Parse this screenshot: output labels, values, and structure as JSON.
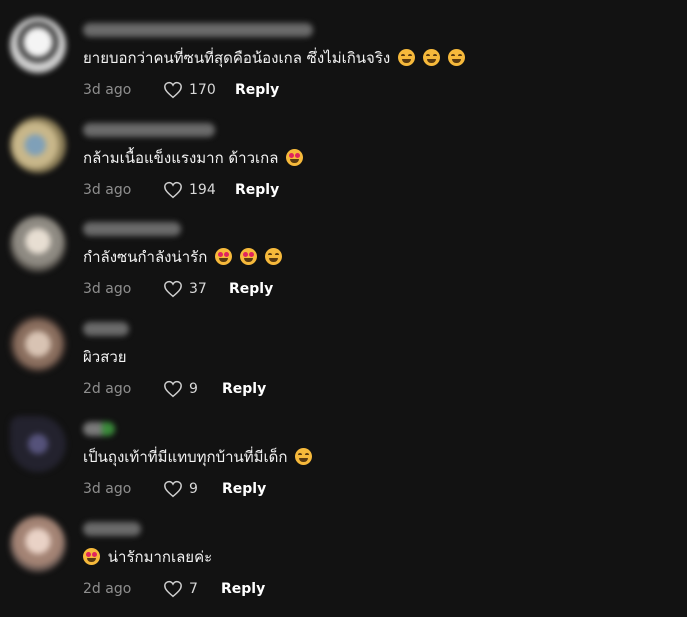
{
  "comments": [
    {
      "text": "ยายบอกว่าคนที่ซนที่สุดคือน้องเกล ซึ่งไม่เกินจริง",
      "emojis": [
        "grin-sweat-icon",
        "grin-sweat-icon",
        "grin-sweat-icon"
      ],
      "time": "3d ago",
      "likes": "170",
      "reply": "Reply",
      "avatar_color": "#d6d6d6"
    },
    {
      "text": "กล้ามเนื้อแข็งแรงมาก ด้าวเกล",
      "emojis": [
        "heart-eyes-icon"
      ],
      "time": "3d ago",
      "likes": "194",
      "reply": "Reply",
      "avatar_color": "#9c9270"
    },
    {
      "text": "กำลังซนกำลังน่ารัก",
      "emojis": [
        "heart-eyes-icon",
        "heart-eyes-icon",
        "joy-icon"
      ],
      "time": "3d ago",
      "likes": "37",
      "reply": "Reply",
      "avatar_color": "#a9a49a"
    },
    {
      "text": "ผิวสวย",
      "emojis": [],
      "time": "2d ago",
      "likes": "9",
      "reply": "Reply",
      "avatar_color": "#b89a86"
    },
    {
      "text": "เป็นถุงเท้าที่มีแทบทุกบ้านที่มีเด็ก",
      "emojis": [
        "rofl-icon"
      ],
      "time": "3d ago",
      "likes": "9",
      "reply": "Reply",
      "avatar_color": "#2c2a3a"
    },
    {
      "text": "น่ารักมากเลยค่ะ",
      "emojis_leading": [
        "heart-eyes-icon"
      ],
      "emojis": [],
      "time": "2d ago",
      "likes": "7",
      "reply": "Reply",
      "avatar_color": "#c7a99c"
    }
  ]
}
